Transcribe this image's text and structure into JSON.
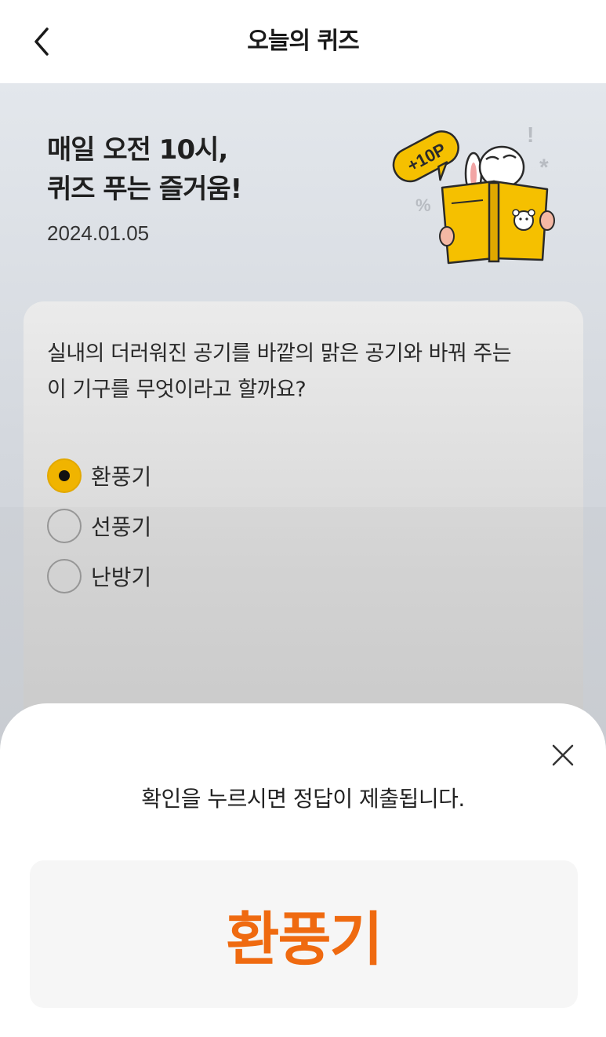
{
  "header": {
    "title": "오늘의 퀴즈",
    "back_icon": "chevron-left-icon"
  },
  "hero": {
    "title_line1": "매일 오전 10시,",
    "title_line2": "퀴즈 푸는 즐거움!",
    "date": "2024.01.05",
    "badge": "+10P"
  },
  "quiz": {
    "question_line1": "실내의 더러워진 공기를 바깥의 맑은 공기와 바꿔 주는",
    "question_line2": "이 기구를 무엇이라고 할까요?",
    "options": [
      {
        "label": "환풍기",
        "selected": true
      },
      {
        "label": "선풍기",
        "selected": false
      },
      {
        "label": "난방기",
        "selected": false
      }
    ]
  },
  "sheet": {
    "message": "확인을 누르시면 정답이 제출됩니다.",
    "answer": "환풍기",
    "close_icon": "close-icon"
  },
  "colors": {
    "accent_yellow": "#f0b400",
    "answer_orange": "#ef6a10"
  }
}
